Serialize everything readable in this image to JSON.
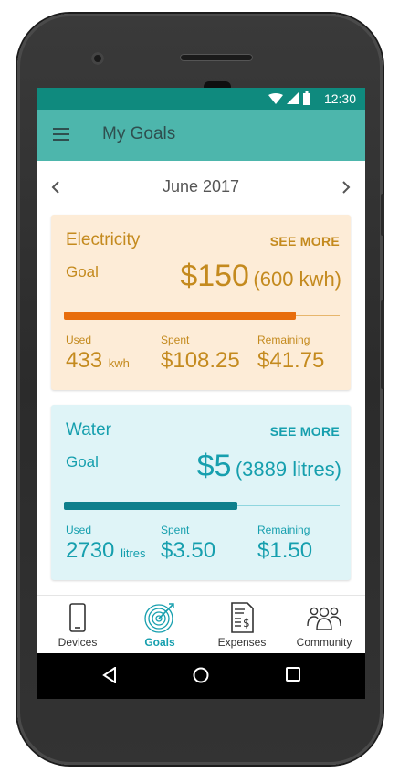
{
  "status_bar": {
    "time": "12:30"
  },
  "app_bar": {
    "title": "My Goals",
    "menu_icon": "menu-icon"
  },
  "month_nav": {
    "label": "June 2017",
    "prev_icon": "chevron-left-icon",
    "next_icon": "chevron-right-icon"
  },
  "cards": {
    "electricity": {
      "name": "Electricity",
      "see_more": "SEE MORE",
      "goal_label": "Goal",
      "goal_amount": "$150",
      "goal_units": "(600 kwh)",
      "progress": 0.84,
      "used_label": "Used",
      "used_value": "433",
      "used_unit": "kwh",
      "spent_label": "Spent",
      "spent_value": "$108.25",
      "remaining_label": "Remaining",
      "remaining_value": "$41.75",
      "accent": "#c48a1e",
      "bar_color": "#e86d0c",
      "background": "#fdecd7"
    },
    "water": {
      "name": "Water",
      "see_more": "SEE MORE",
      "goal_label": "Goal",
      "goal_amount": "$5",
      "goal_units": "(3889 litres)",
      "progress": 0.63,
      "used_label": "Used",
      "used_value": "2730",
      "used_unit": "litres",
      "spent_label": "Spent",
      "spent_value": "$3.50",
      "remaining_label": "Remaining",
      "remaining_value": "$1.50",
      "accent": "#169fae",
      "bar_color": "#0e7f8c",
      "background": "#dff4f7"
    }
  },
  "bottom_nav": {
    "items": [
      {
        "label": "Devices",
        "icon": "phone-device-icon",
        "active": false
      },
      {
        "label": "Goals",
        "icon": "target-icon",
        "active": true
      },
      {
        "label": "Expenses",
        "icon": "receipt-icon",
        "active": false
      },
      {
        "label": "Community",
        "icon": "people-group-icon",
        "active": false
      }
    ]
  },
  "system_nav": {
    "back_icon": "back-triangle-icon",
    "home_icon": "home-circle-icon",
    "recents_icon": "recents-square-icon"
  },
  "colors": {
    "status_bar": "#0f8a7e",
    "app_bar": "#4db6ac",
    "active_nav": "#169fae"
  }
}
